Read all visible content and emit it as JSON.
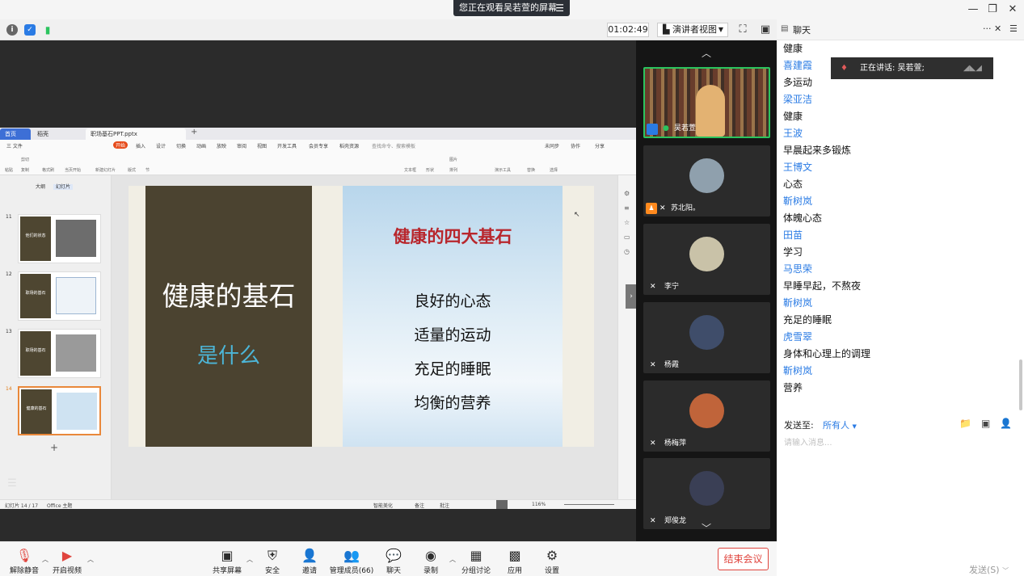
{
  "window": {
    "share_banner": "您正在观看吴若萱的屏幕",
    "banner_menu_glyph": "☰",
    "minimize": "—",
    "restore": "❐",
    "close": "✕"
  },
  "meeting_bar": {
    "timer": "01:02:49",
    "view_mode": "演讲者视图"
  },
  "ppt": {
    "tabs": [
      "首页",
      "稻壳",
      "职场基石PPT.pptx"
    ],
    "menu_items": [
      "三 文件",
      "开始",
      "插入",
      "设计",
      "切换",
      "动画",
      "放映",
      "审阅",
      "视图",
      "开发工具",
      "会员专享",
      "稻壳资源",
      "查找命令、搜索模板",
      "未同步",
      "协作",
      "分享"
    ],
    "ribbon_labels": [
      "粘贴",
      "剪切",
      "复制",
      "格式刷",
      "当页开始",
      "新建幻灯片",
      "版式",
      "节",
      "文本框",
      "形状",
      "排列",
      "图片",
      "演示工具",
      "替换",
      "选择"
    ],
    "thumb_tabs": [
      "大纲",
      "幻灯片"
    ],
    "thumbnails": [
      {
        "num": "11",
        "label": "他们的状态"
      },
      {
        "num": "12",
        "label": "职场的基石"
      },
      {
        "num": "13",
        "label": "职场的基石"
      },
      {
        "num": "14",
        "label": "健康的基石"
      }
    ],
    "thumb_add": "+",
    "status_left": "幻灯片 14 / 17",
    "status_theme": "Office 主题",
    "status_beautify": "智能美化",
    "status_notes": "备注",
    "status_comment": "批注",
    "status_zoom": "116%"
  },
  "slide": {
    "left_title": "健康的基石",
    "left_subtitle": "是什么",
    "right_title": "健康的四大基石",
    "items": [
      "良好的心态",
      "适量的运动",
      "充足的睡眠",
      "均衡的营养"
    ]
  },
  "video_panel": {
    "up_arrow": "︿",
    "down_arrow": "﹀",
    "participants": [
      {
        "name": "吴若萱",
        "muted": false
      },
      {
        "name": "苏北阳。",
        "muted": true
      },
      {
        "name": "李宁",
        "muted": true
      },
      {
        "name": "杨霞",
        "muted": true
      },
      {
        "name": "杨梅萍",
        "muted": true
      },
      {
        "name": "郑俊龙",
        "muted": true
      }
    ]
  },
  "chat": {
    "title": "聊天",
    "more_glyph": "···",
    "close_glyph": "✕",
    "speaking": "正在讲话: 吴若萱;",
    "messages": [
      {
        "sender": "",
        "text": "健康"
      },
      {
        "sender": "喜建霞",
        "text": "多运动"
      },
      {
        "sender": "梁亚洁",
        "text": "健康"
      },
      {
        "sender": "王波",
        "text": "早晨起来多锻炼"
      },
      {
        "sender": "王博文",
        "text": "心态"
      },
      {
        "sender": "靳树岚",
        "text": "体魄心态"
      },
      {
        "sender": "田苗",
        "text": "学习"
      },
      {
        "sender": "马思荣",
        "text": "早睡早起，不熬夜"
      },
      {
        "sender": "靳树岚",
        "text": "充足的睡眠"
      },
      {
        "sender": "虎雪翠",
        "text": "身体和心理上的调理"
      },
      {
        "sender": "靳树岚",
        "text": "营养"
      }
    ],
    "send_to_label": "发送至:",
    "send_to_value": "所有人",
    "input_placeholder": "请输入消息...",
    "send_button": "发送(S)"
  },
  "toolbar": {
    "items": [
      {
        "label": "解除静音",
        "icon": "mic-muted-icon"
      },
      {
        "label": "开启视频",
        "icon": "video-off-icon"
      },
      {
        "label": "共享屏幕",
        "icon": "share-screen-icon"
      },
      {
        "label": "安全",
        "icon": "shield-icon"
      },
      {
        "label": "邀请",
        "icon": "invite-icon"
      },
      {
        "label": "管理成员(66)",
        "icon": "members-icon"
      },
      {
        "label": "聊天",
        "icon": "chat-icon"
      },
      {
        "label": "录制",
        "icon": "record-icon"
      },
      {
        "label": "分组讨论",
        "icon": "breakout-icon"
      },
      {
        "label": "应用",
        "icon": "apps-icon"
      },
      {
        "label": "设置",
        "icon": "gear-icon"
      }
    ],
    "end_meeting": "结束会议"
  },
  "colors": {
    "accent_blue": "#2a7be4",
    "end_red": "#e0453e",
    "active_green": "#2bc45e",
    "slide_dark": "#4b4330",
    "slide_title_red": "#b8262c",
    "slide_sub_blue": "#4cb6d8"
  }
}
